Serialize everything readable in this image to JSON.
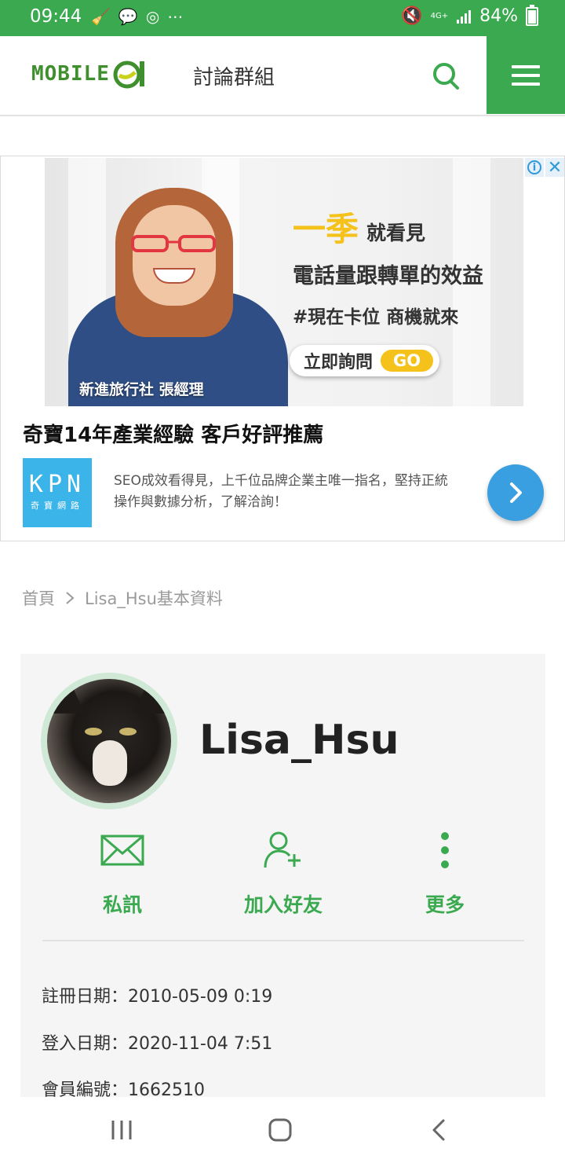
{
  "status_bar": {
    "time": "09:44",
    "network": "4G+",
    "battery": "84%"
  },
  "header": {
    "logo_text": "MOBILE",
    "section_title": "討論群組"
  },
  "ad": {
    "banner": {
      "caption": "新進旅行社 張經理",
      "big": "一季",
      "small": "就看見",
      "line2": "電話量跟轉單的效益",
      "line3": "#現在卡位 商機就來",
      "cta": "立即詢問",
      "go": "GO"
    },
    "headline": "奇寶14年產業經驗 客戶好評推薦",
    "logo_text": "KPN",
    "logo_sub": "奇寶網路",
    "description": "SEO成效看得見，上千位品牌企業主唯一指名，堅持正統操作與數據分析，了解洽詢！"
  },
  "breadcrumb": {
    "home": "首頁",
    "current": "Lisa_Hsu基本資料"
  },
  "profile": {
    "username": "Lisa_Hsu",
    "actions": [
      "私訊",
      "加入好友",
      "更多"
    ],
    "info": [
      "註冊日期：2010-05-09 0:19",
      "登入日期：2020-11-04 7:51",
      "會員編號：1662510"
    ]
  },
  "colors": {
    "brand_green": "#3aa94f",
    "ad_blue": "#3a9fe0",
    "ad_yellow": "#f4c21a"
  }
}
